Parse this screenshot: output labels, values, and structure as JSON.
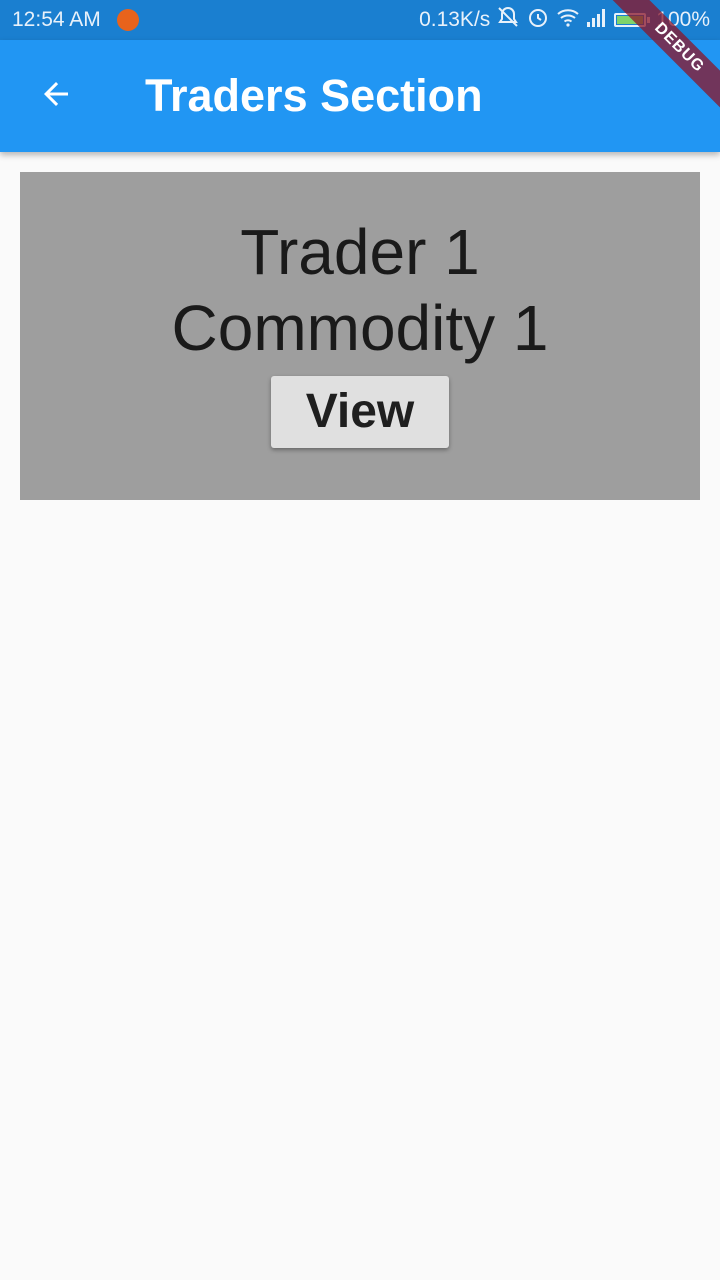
{
  "status_bar": {
    "time": "12:54 AM",
    "network_speed": "0.13K/s",
    "battery": "100%",
    "icons": [
      "app-notification-icon",
      "mute-icon",
      "alarm-icon",
      "wifi-icon",
      "signal-icon",
      "battery-icon"
    ]
  },
  "app_bar": {
    "title": "Traders Section",
    "back_icon": "arrow-left-icon",
    "color": "#2196f3"
  },
  "debug_banner": "DEBUG",
  "trader_card": {
    "trader": "Trader 1",
    "commodity": "Commodity 1",
    "view_label": "View",
    "background": "#9e9e9e"
  }
}
